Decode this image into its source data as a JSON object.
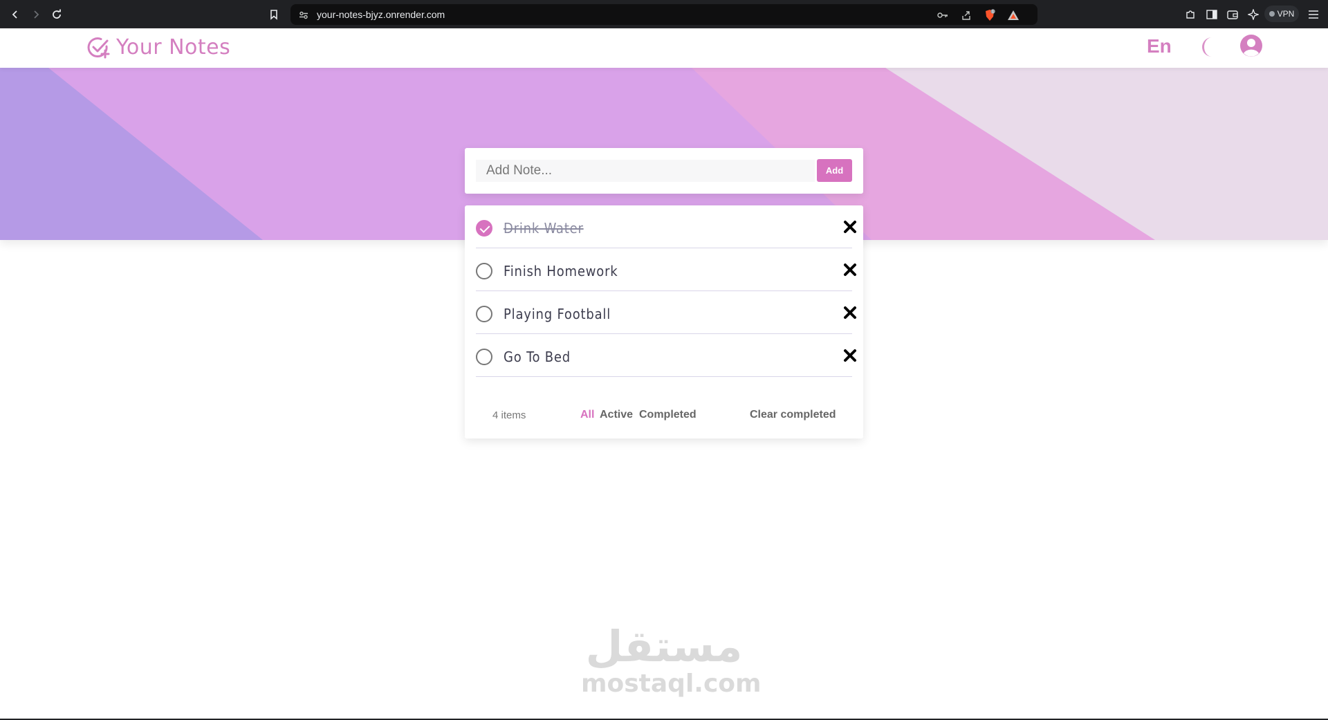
{
  "browser": {
    "url": "your-notes-bjyz.onrender.com",
    "vpn_label": "VPN",
    "shield_count": "1"
  },
  "header": {
    "app_title": "Your Notes",
    "language": "En"
  },
  "add_note": {
    "placeholder": "Add Note...",
    "value": "",
    "button_label": "Add"
  },
  "notes": [
    {
      "text": "Drink Water",
      "completed": true
    },
    {
      "text": "Finish Homework",
      "completed": false
    },
    {
      "text": "Playing Football",
      "completed": false
    },
    {
      "text": "Go To Bed",
      "completed": false
    }
  ],
  "footer": {
    "count_label": "4 items",
    "filters": [
      "All",
      "Active",
      "Completed"
    ],
    "active_filter": "All",
    "clear_label": "Clear completed"
  },
  "watermark": {
    "arabic": "مستقل",
    "latin": "mostaql.com"
  },
  "colors": {
    "accent": "#d772bf",
    "hero_left": "#b39be6",
    "hero_mid": "#dba3e8",
    "hero_right": "#e9dcea"
  }
}
